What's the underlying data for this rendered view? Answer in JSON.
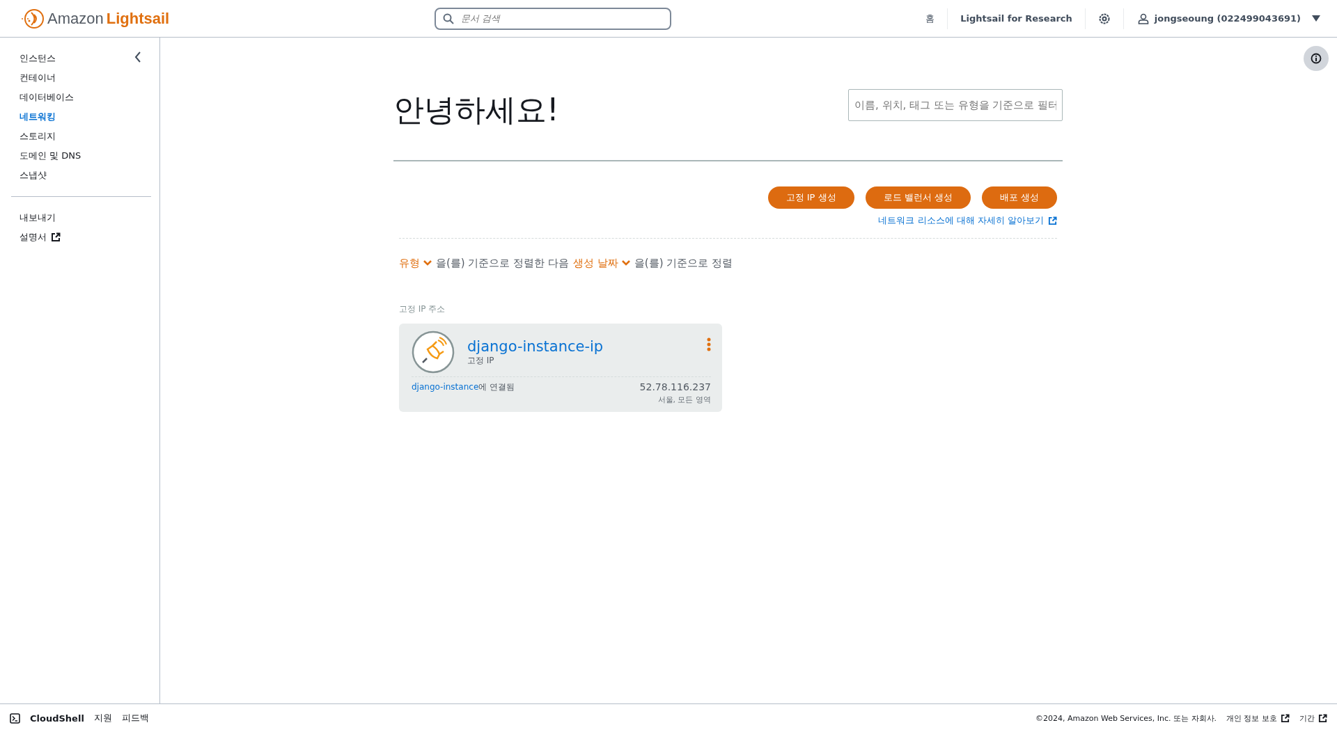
{
  "header": {
    "logo_text": "Amazon",
    "logo_brand": "Lightsail",
    "search": {
      "placeholder": "문서 검색"
    },
    "nav": [
      "홈",
      "Lightsail for Research"
    ],
    "user": "jongseoung (022499043691)"
  },
  "sidebar": {
    "items": [
      {
        "label": "인스턴스",
        "selected": false
      },
      {
        "label": "컨테이너",
        "selected": false
      },
      {
        "label": "데이터베이스",
        "selected": false
      },
      {
        "label": "네트워킹",
        "selected": true
      },
      {
        "label": "스토리지",
        "selected": false
      },
      {
        "label": "도메인 및 DNS",
        "selected": false
      },
      {
        "label": "스냅샷",
        "selected": false
      }
    ],
    "secondary": [
      {
        "label": "내보내기",
        "external": false
      },
      {
        "label": "설명서",
        "external": true
      }
    ]
  },
  "main": {
    "greeting": "안녕하세요!",
    "filter": {
      "placeholder": "이름, 위치, 태그 또는 유형을 기준으로 필터"
    },
    "buttons": [
      "고정 IP 생성",
      "로드 밸런서 생성",
      "배포 생성"
    ],
    "learn_link": "네트워크 리소스에 대해 자세히 알아보기",
    "sort": {
      "first": "유형",
      "middle": "을(를) 기준으로 정렬한 다음",
      "second": "생성 날짜",
      "end": "을(를) 기준으로 정렬"
    },
    "section_title": "고정 IP 주소",
    "cards": [
      {
        "name": "django-instance-ip",
        "type": "고정 IP",
        "attached_link": "django-instance",
        "attached_suffix": "에 연결됨",
        "ip": "52.78.116.237",
        "region": "서울, 모든 영역"
      }
    ]
  },
  "footer": {
    "left": [
      "CloudShell",
      "지원",
      "피드백"
    ],
    "copyright": "©2024, Amazon Web Services, Inc. 또는 자회사.",
    "links": [
      "개인 정보 보호",
      "기간"
    ]
  }
}
